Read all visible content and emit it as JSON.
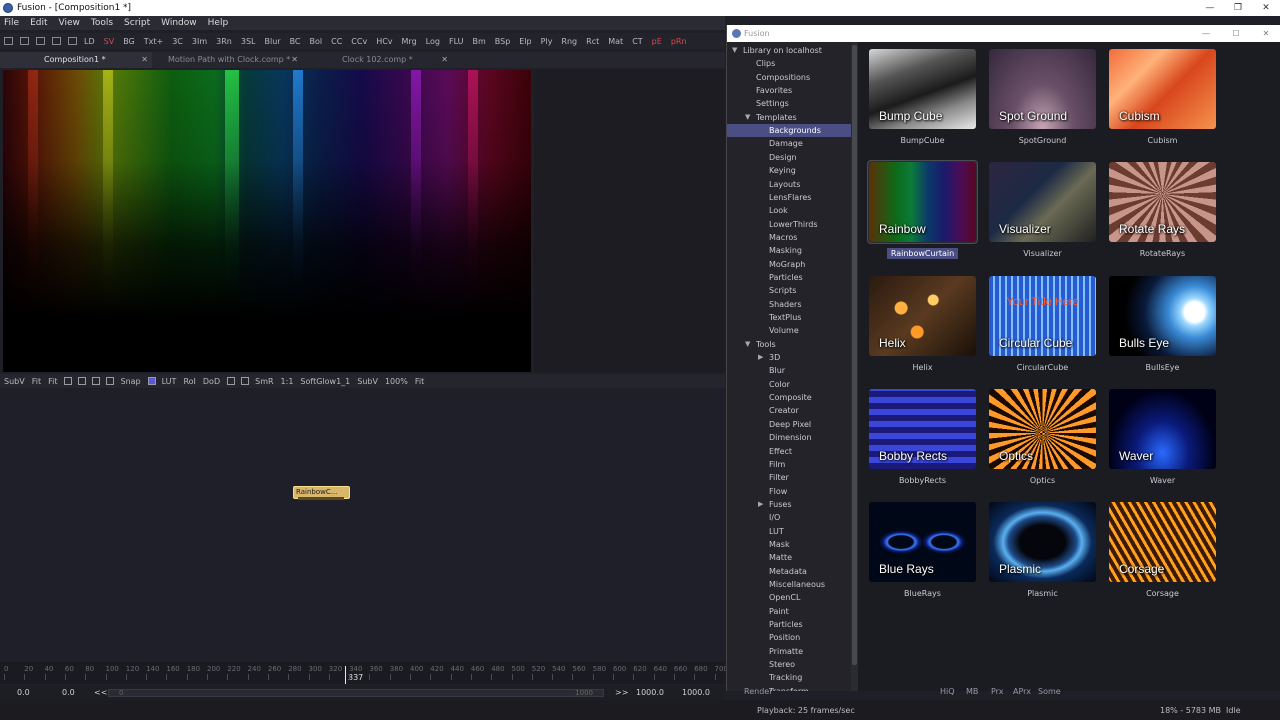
{
  "window": {
    "title": "Fusion - [Composition1 *]",
    "controls": [
      "—",
      "❐",
      "✕"
    ]
  },
  "menu": [
    "File",
    "Edit",
    "View",
    "Tools",
    "Script",
    "Window",
    "Help"
  ],
  "toolbar": [
    "LD",
    "SV",
    "BG",
    "Txt+",
    "3C",
    "3Im",
    "3Rn",
    "3SL",
    "Blur",
    "BC",
    "Bol",
    "CC",
    "CCv",
    "HCv",
    "Mrg",
    "Log",
    "FLU",
    "Bm",
    "BSp",
    "Elp",
    "Ply",
    "Rng",
    "Rct",
    "Mat",
    "CT",
    "pE",
    "pRn"
  ],
  "tabs": [
    {
      "label": "Composition1 *",
      "close": "✕"
    },
    {
      "label": "Motion Path with Clock.comp *",
      "close": "✕"
    },
    {
      "label": "Clock 102.comp *",
      "close": "✕"
    }
  ],
  "viewer_controls": {
    "left": [
      "SubV",
      "Fit",
      "Fit",
      "Snap",
      "LUT",
      "RoI",
      "DoD",
      "SmR",
      "1:1",
      "SoftGlow1_1"
    ],
    "right": [
      "SubV",
      "100%",
      "Fit"
    ]
  },
  "node": {
    "label": "RainbowC..."
  },
  "ruler": {
    "labels": [
      "0",
      "20",
      "40",
      "60",
      "80",
      "100",
      "120",
      "140",
      "160",
      "180",
      "200",
      "220",
      "240",
      "260",
      "280",
      "300",
      "320",
      "340",
      "360",
      "380",
      "400",
      "420",
      "440",
      "460",
      "480",
      "500",
      "520",
      "540",
      "560",
      "580",
      "600",
      "620",
      "640",
      "660",
      "680",
      "700"
    ],
    "current_frame": "337"
  },
  "transport": {
    "start_global": "0.0",
    "start_render": "0.0",
    "rewind": "<<",
    "range_start": "0",
    "range_end": "1000",
    "fwd": ">>",
    "end_render": "1000.0",
    "end_global": "1000.0"
  },
  "status": {
    "render_button": "Render",
    "toggles": [
      "HiQ",
      "MB",
      "Prx",
      "APrx",
      "Some"
    ],
    "playback": "Playback: 25 frames/sec",
    "memory": "18% - 5783 MB",
    "state": "Idle"
  },
  "bin": {
    "title": "Fusion",
    "controls": [
      "—",
      "☐",
      "✕"
    ],
    "tree": [
      {
        "label": "Library on localhost",
        "level": 0,
        "expanded": true
      },
      {
        "label": "Clips",
        "level": 1
      },
      {
        "label": "Compositions",
        "level": 1
      },
      {
        "label": "Favorites",
        "level": 1
      },
      {
        "label": "Settings",
        "level": 1
      },
      {
        "label": "Templates",
        "level": 1,
        "expanded": true
      },
      {
        "label": "Backgrounds",
        "level": 2,
        "selected": true
      },
      {
        "label": "Damage",
        "level": 2
      },
      {
        "label": "Design",
        "level": 2
      },
      {
        "label": "Keying",
        "level": 2
      },
      {
        "label": "Layouts",
        "level": 2
      },
      {
        "label": "LensFlares",
        "level": 2
      },
      {
        "label": "Look",
        "level": 2
      },
      {
        "label": "LowerThirds",
        "level": 2
      },
      {
        "label": "Macros",
        "level": 2
      },
      {
        "label": "Masking",
        "level": 2
      },
      {
        "label": "MoGraph",
        "level": 2
      },
      {
        "label": "Particles",
        "level": 2
      },
      {
        "label": "Scripts",
        "level": 2
      },
      {
        "label": "Shaders",
        "level": 2
      },
      {
        "label": "TextPlus",
        "level": 2
      },
      {
        "label": "Volume",
        "level": 2
      },
      {
        "label": "Tools",
        "level": 1,
        "expanded": true
      },
      {
        "label": "3D",
        "level": 2,
        "collapsed": true
      },
      {
        "label": "Blur",
        "level": 2
      },
      {
        "label": "Color",
        "level": 2
      },
      {
        "label": "Composite",
        "level": 2
      },
      {
        "label": "Creator",
        "level": 2
      },
      {
        "label": "Deep Pixel",
        "level": 2
      },
      {
        "label": "Dimension",
        "level": 2
      },
      {
        "label": "Effect",
        "level": 2
      },
      {
        "label": "Film",
        "level": 2
      },
      {
        "label": "Filter",
        "level": 2
      },
      {
        "label": "Flow",
        "level": 2
      },
      {
        "label": "Fuses",
        "level": 2,
        "collapsed": true
      },
      {
        "label": "I/O",
        "level": 2
      },
      {
        "label": "LUT",
        "level": 2
      },
      {
        "label": "Mask",
        "level": 2
      },
      {
        "label": "Matte",
        "level": 2
      },
      {
        "label": "Metadata",
        "level": 2
      },
      {
        "label": "Miscellaneous",
        "level": 2
      },
      {
        "label": "OpenCL",
        "level": 2
      },
      {
        "label": "Paint",
        "level": 2
      },
      {
        "label": "Particles",
        "level": 2
      },
      {
        "label": "Position",
        "level": 2
      },
      {
        "label": "Primatte",
        "level": 2
      },
      {
        "label": "Stereo",
        "level": 2
      },
      {
        "label": "Tracking",
        "level": 2
      },
      {
        "label": "Transform",
        "level": 2
      }
    ],
    "templates": [
      {
        "thumb_label": "Bump Cube",
        "caption": "BumpCube",
        "style": "t-bump"
      },
      {
        "thumb_label": "Spot Ground",
        "caption": "SpotGround",
        "style": "t-spot"
      },
      {
        "thumb_label": "Cubism",
        "caption": "Cubism",
        "style": "t-cubism"
      },
      {
        "thumb_label": "Rainbow",
        "caption": "RainbowCurtain",
        "style": "t-rainbow",
        "selected": true
      },
      {
        "thumb_label": "Visualizer",
        "caption": "Visualizer",
        "style": "t-visual"
      },
      {
        "thumb_label": "Rotate Rays",
        "caption": "RotateRays",
        "style": "t-rotate"
      },
      {
        "thumb_label": "Helix",
        "caption": "Helix",
        "style": "t-helix"
      },
      {
        "thumb_label": "Circular Cube",
        "caption": "CircularCube",
        "style": "t-circular",
        "overlay": "Your Title Here"
      },
      {
        "thumb_label": "Bulls Eye",
        "caption": "BullsEye",
        "style": "t-bulls"
      },
      {
        "thumb_label": "Bobby Rects",
        "caption": "BobbyRects",
        "style": "t-bobby"
      },
      {
        "thumb_label": "Optics",
        "caption": "Optics",
        "style": "t-optics"
      },
      {
        "thumb_label": "Waver",
        "caption": "Waver",
        "style": "t-waver"
      },
      {
        "thumb_label": "Blue Rays",
        "caption": "BlueRays",
        "style": "t-bluerays"
      },
      {
        "thumb_label": "Plasmic",
        "caption": "Plasmic",
        "style": "t-plasmic"
      },
      {
        "thumb_label": "Corsage",
        "caption": "Corsage",
        "style": "t-corsage"
      }
    ]
  }
}
